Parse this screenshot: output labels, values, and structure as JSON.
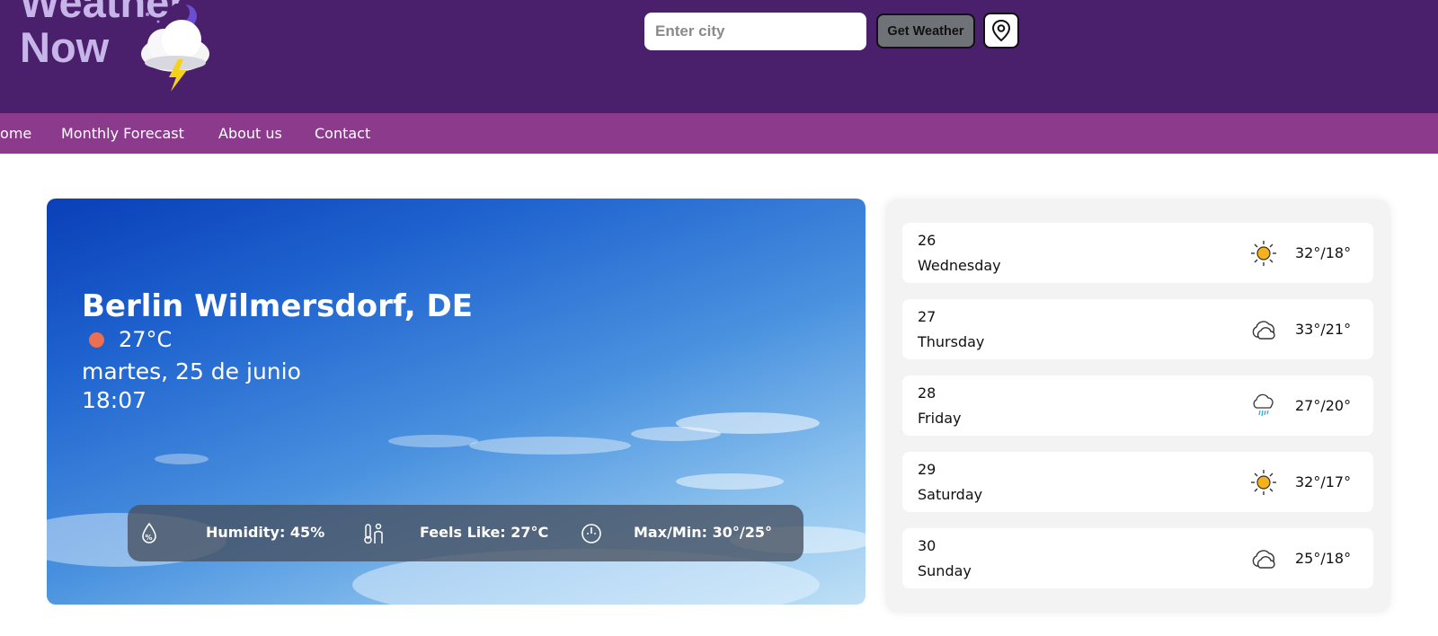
{
  "app": {
    "logo_line1": "Weather",
    "logo_line2": "Now"
  },
  "search": {
    "placeholder": "Enter city",
    "button_label": "Get Weather"
  },
  "nav": {
    "items": [
      "Home",
      "Monthly Forecast",
      "About us",
      "Contact"
    ]
  },
  "current": {
    "city": "Berlin Wilmersdorf, DE",
    "temperature": "27°C",
    "date": "martes, 25 de junio",
    "time": "18:07",
    "humidity": "Humidity: 45%",
    "feels_like": "Feels Like: 27°C",
    "max_min": "Max/Min: 30°/25°",
    "accent_color": "#ec6f52"
  },
  "forecast": [
    {
      "day_num": "26",
      "day_name": "Wednesday",
      "range": "32°/18°",
      "icon": "sun-icon"
    },
    {
      "day_num": "27",
      "day_name": "Thursday",
      "range": "33°/21°",
      "icon": "cloud-icon"
    },
    {
      "day_num": "28",
      "day_name": "Friday",
      "range": "27°/20°",
      "icon": "rain-cloud-icon"
    },
    {
      "day_num": "29",
      "day_name": "Saturday",
      "range": "32°/17°",
      "icon": "sun-icon"
    },
    {
      "day_num": "30",
      "day_name": "Sunday",
      "range": "25°/18°",
      "icon": "cloud-icon"
    }
  ],
  "colors": {
    "header": "#4a1f6b",
    "nav": "#8b3a8c",
    "panel": "#f3f3f3"
  }
}
